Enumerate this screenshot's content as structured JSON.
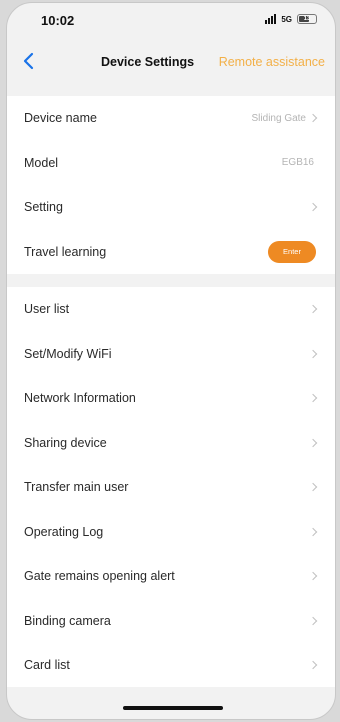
{
  "status": {
    "time": "10:02",
    "network": "5G",
    "battery": "13"
  },
  "nav": {
    "title": "Device Settings",
    "remote": "Remote assistance"
  },
  "group1": {
    "device_name": {
      "label": "Device name",
      "value": "Sliding Gate"
    },
    "model": {
      "label": "Model",
      "value": "EGB16"
    },
    "setting": {
      "label": "Setting"
    },
    "travel": {
      "label": "Travel learning",
      "button": "Enter"
    }
  },
  "menu": [
    {
      "label": "User list"
    },
    {
      "label": "Set/Modify WiFi"
    },
    {
      "label": "Network Information"
    },
    {
      "label": "Sharing device"
    },
    {
      "label": "Transfer main user"
    },
    {
      "label": "Operating Log"
    },
    {
      "label": "Gate remains opening alert"
    },
    {
      "label": "Binding camera"
    },
    {
      "label": "Card list"
    }
  ],
  "colors": {
    "accent": "#ee8a23",
    "remote_text": "#f3b048",
    "background": "#f2f2f2"
  }
}
